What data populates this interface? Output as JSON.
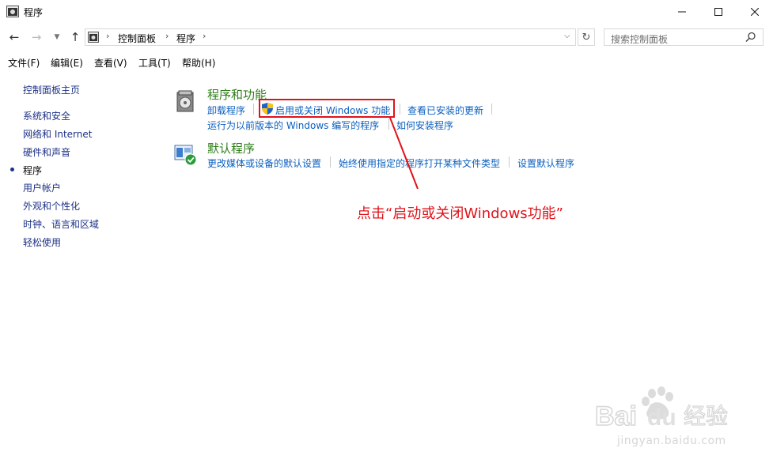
{
  "window": {
    "title": "程序"
  },
  "nav": {
    "breadcrumbs": [
      "控制面板",
      "程序"
    ],
    "search_placeholder": "搜索控制面板"
  },
  "menu": [
    "文件(F)",
    "编辑(E)",
    "查看(V)",
    "工具(T)",
    "帮助(H)"
  ],
  "sidebar": {
    "home": "控制面板主页",
    "items": [
      "系统和安全",
      "网络和 Internet",
      "硬件和声音",
      "程序",
      "用户帐户",
      "外观和个性化",
      "时钟、语言和区域",
      "轻松使用"
    ],
    "active": "程序"
  },
  "categories": [
    {
      "title": "程序和功能",
      "icon": "programs-features-icon",
      "links": [
        "卸载程序",
        "启用或关闭 Windows 功能",
        "查看已安装的更新",
        "运行为以前版本的 Windows 编写的程序",
        "如何安装程序"
      ]
    },
    {
      "title": "默认程序",
      "icon": "default-programs-icon",
      "links": [
        "更改媒体或设备的默认设置",
        "始终使用指定的程序打开某种文件类型",
        "设置默认程序"
      ]
    }
  ],
  "annotation": {
    "text": "点击“启动或关闭Windows功能”",
    "color": "#e0131b"
  },
  "watermark": {
    "brand": "Baidu经验",
    "url": "jingyan.baidu.com"
  },
  "colors": {
    "link": "#0b5fbf",
    "category_title": "#2e7d19",
    "sidebar_link": "#1e3287"
  }
}
